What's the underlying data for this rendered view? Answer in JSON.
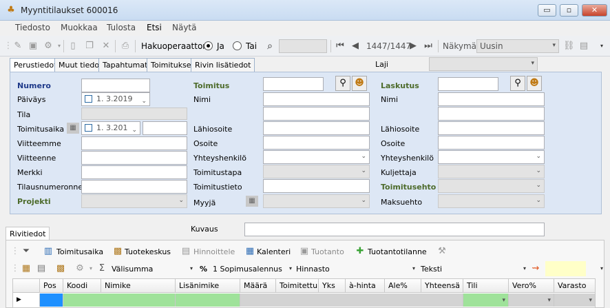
{
  "window": {
    "title": "Myyntitilaukset 600016",
    "minimize": "▭",
    "restore": "▫",
    "close": "✕"
  },
  "menu": [
    "Tiedosto",
    "Muokkaa",
    "Tulosta",
    "Etsi",
    "Näytä"
  ],
  "toolbar": {
    "search_operator_label": "Hakuoperaattori",
    "and_label": "Ja",
    "or_label": "Tai",
    "search_value": "",
    "record_position": "1447/1447",
    "view_label": "Näkymä",
    "view_value": "Uusin"
  },
  "tabs": [
    "Perustiedot",
    "Muut tiedot",
    "Tapahtumat",
    "Toimitukset",
    "Rivin lisätiedot"
  ],
  "laji_label": "Laji",
  "form": {
    "left": {
      "numero": "Numero",
      "paivays": "Päiväys",
      "paivays_value": "1. 3.2019",
      "tila": "Tila",
      "toimitusaika": "Toimitusaika",
      "toimitusaika_value": "1. 3.201",
      "viitteemme": "Viitteemme",
      "viitteenne": "Viitteenne",
      "merkki": "Merkki",
      "tilausnumeronne": "Tilausnumeronne",
      "projekti": "Projekti"
    },
    "mid": {
      "toimitus": "Toimitus",
      "nimi": "Nimi",
      "lahiosoite": "Lähiosoite",
      "osoite": "Osoite",
      "yhteyshenkilo": "Yhteyshenkilö",
      "toimitustapa": "Toimitustapa",
      "toimitustieto": "Toimitustieto",
      "myyja": "Myyjä"
    },
    "right": {
      "laskutus": "Laskutus",
      "nimi": "Nimi",
      "lahiosoite": "Lähiosoite",
      "osoite": "Osoite",
      "yhteyshenkilo": "Yhteyshenkilö",
      "kuljettaja": "Kuljettaja",
      "toimitusehto": "Toimitusehto",
      "maksuehto": "Maksuehto"
    }
  },
  "rivitiedot_tab": "Rivitiedot",
  "kuvaus_label": "Kuvaus",
  "row_toolbar": [
    "Toimitusaika",
    "Tuotekeskus",
    "Hinnoittele",
    "Kalenteri",
    "Tuotanto",
    "Tuotantotilanne"
  ],
  "row_toolbar2": {
    "sum": "Välisumma",
    "percent": "%",
    "discount": "1 Sopimusalennus",
    "price": "Hinnasto",
    "text": "Teksti"
  },
  "grid_columns": [
    "Pos",
    "Koodi",
    "Nimike",
    "Lisänimike",
    "Määrä",
    "Toimitettu",
    "Yks",
    "à-hinta",
    "Ale%",
    "Yhteensä",
    "Tili",
    "Vero%",
    "Varasto"
  ],
  "colors": {
    "form_bg": "#dde7f5",
    "label_navy": "#1f3a8a",
    "label_green": "#4d6b2b",
    "cell_green": "#9fe29a",
    "cell_blue": "#1e90ff",
    "highlight_yellow": "#ffffc8"
  }
}
